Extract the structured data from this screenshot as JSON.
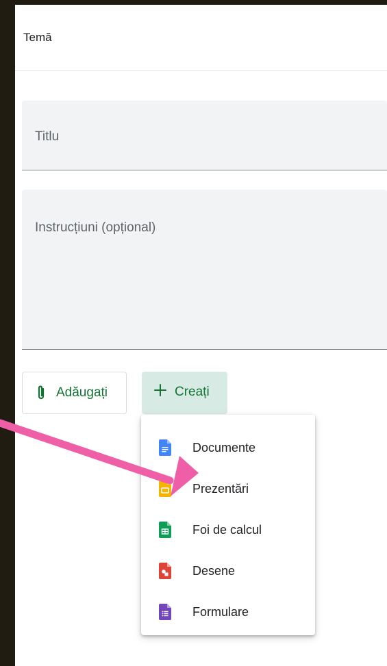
{
  "header": {
    "title": "Temă"
  },
  "form": {
    "title_placeholder": "Titlu",
    "instructions_placeholder": "Instrucțiuni (opțional)"
  },
  "actions": {
    "add_label": "Adăugați",
    "add_icon": "paperclip-icon",
    "create_label": "Creați",
    "create_icon": "plus-icon"
  },
  "create_menu": {
    "items": [
      {
        "label": "Documente",
        "icon": "google-docs-icon",
        "color": "#4285f4"
      },
      {
        "label": "Prezentări",
        "icon": "google-slides-icon",
        "color": "#f4b400"
      },
      {
        "label": "Foi de calcul",
        "icon": "google-sheets-icon",
        "color": "#0f9d58"
      },
      {
        "label": "Desene",
        "icon": "google-drawings-icon",
        "color": "#db4437"
      },
      {
        "label": "Formulare",
        "icon": "google-forms-icon",
        "color": "#7248b9"
      }
    ]
  },
  "annotation": {
    "arrow_color": "#ef5fa7"
  },
  "colors": {
    "accent_text": "#137333",
    "create_button_bg": "#d7ebe4",
    "field_bg": "#f1f3f4",
    "frame_bg": "#211c12"
  }
}
